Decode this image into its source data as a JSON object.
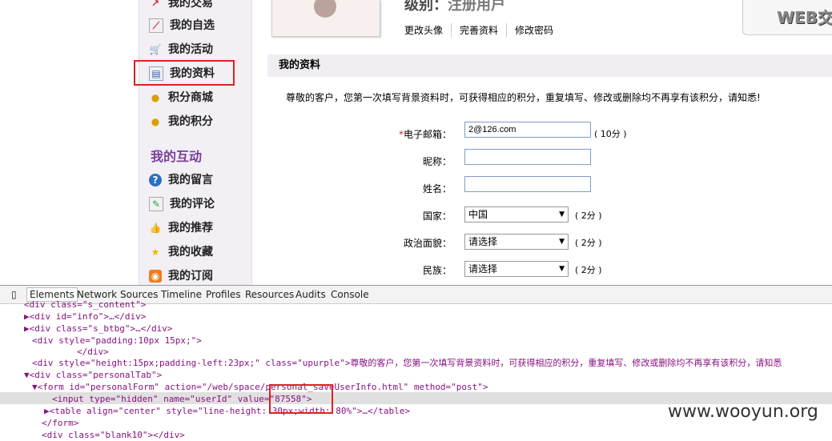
{
  "sidebar": {
    "items": [
      {
        "label": "我的交易",
        "icon": "trade-icon"
      },
      {
        "label": "我的自选",
        "icon": "chart-icon"
      },
      {
        "label": "我的活动",
        "icon": "cart-icon"
      },
      {
        "label": "我的资料",
        "icon": "id-card-icon"
      },
      {
        "label": "积分商城",
        "icon": "coins-icon"
      },
      {
        "label": "我的积分",
        "icon": "coins-icon"
      }
    ],
    "section_title": "我的互动",
    "section_items": [
      {
        "label": "我的留言",
        "icon": "question-icon"
      },
      {
        "label": "我的评论",
        "icon": "edit-icon"
      },
      {
        "label": "我的推荐",
        "icon": "thumbs-up-icon"
      },
      {
        "label": "我的收藏",
        "icon": "star-icon"
      },
      {
        "label": "我的订阅",
        "icon": "rss-icon"
      }
    ]
  },
  "profile": {
    "level_label": "级别：",
    "level_value": "注册用户",
    "links": [
      "更改头像",
      "完善资料",
      "修改密码"
    ],
    "web_badge": "WEB交"
  },
  "section": {
    "title": "我的资料",
    "notice": "尊敬的客户，您第一次填写背景资料时，可获得相应的积分，重复填写、修改或删除均不再享有该积分，请知悉!"
  },
  "form": {
    "email_label": "电子邮箱：",
    "email_value": "2@126.com",
    "email_points": "( 10分 )",
    "nickname_label": "昵称：",
    "name_label": "姓名：",
    "country_label": "国家：",
    "country_value": "中国",
    "country_points": "( 2分 )",
    "political_label": "政治面貌：",
    "political_value": "请选择",
    "political_points": "( 2分 )",
    "ethnic_label": "民族：",
    "ethnic_value": "请选择",
    "ethnic_points": "( 2分 )"
  },
  "devtools": {
    "tabs": [
      "Elements",
      "Network",
      "Sources",
      "Timeline",
      "Profiles",
      "Resources",
      "Audits",
      "Console"
    ],
    "lines": [
      "<div class=\"s_content\">",
      "▶<div id=\"info\">…</div>",
      "▶<div class=\"s_btbg\">…</div>",
      "<div style=\"padding:10px 15px;\">",
      "</div>",
      "<div style=\"height:15px;padding-left:23px;\" class=\"upurple\">尊敬的客户，您第一次填写背景资料时，可获得相应的积分，重复填写、修改或删除均不再享有该积分，请知悉",
      "▼<div class=\"personalTab\">",
      "▼<form id=\"personalForm\" action=\"/web/space/personal_saveUserInfo.html\" method=\"post\">",
      "<input type=\"hidden\" name=\"userId\" value=\"87558\">",
      "▶<table align=\"center\" style=\"line-height: 30px;width: 80%\">…</table>",
      "</form>",
      "<div class=\"blank10\"></div>"
    ]
  },
  "watermark": "www.wooyun.org"
}
